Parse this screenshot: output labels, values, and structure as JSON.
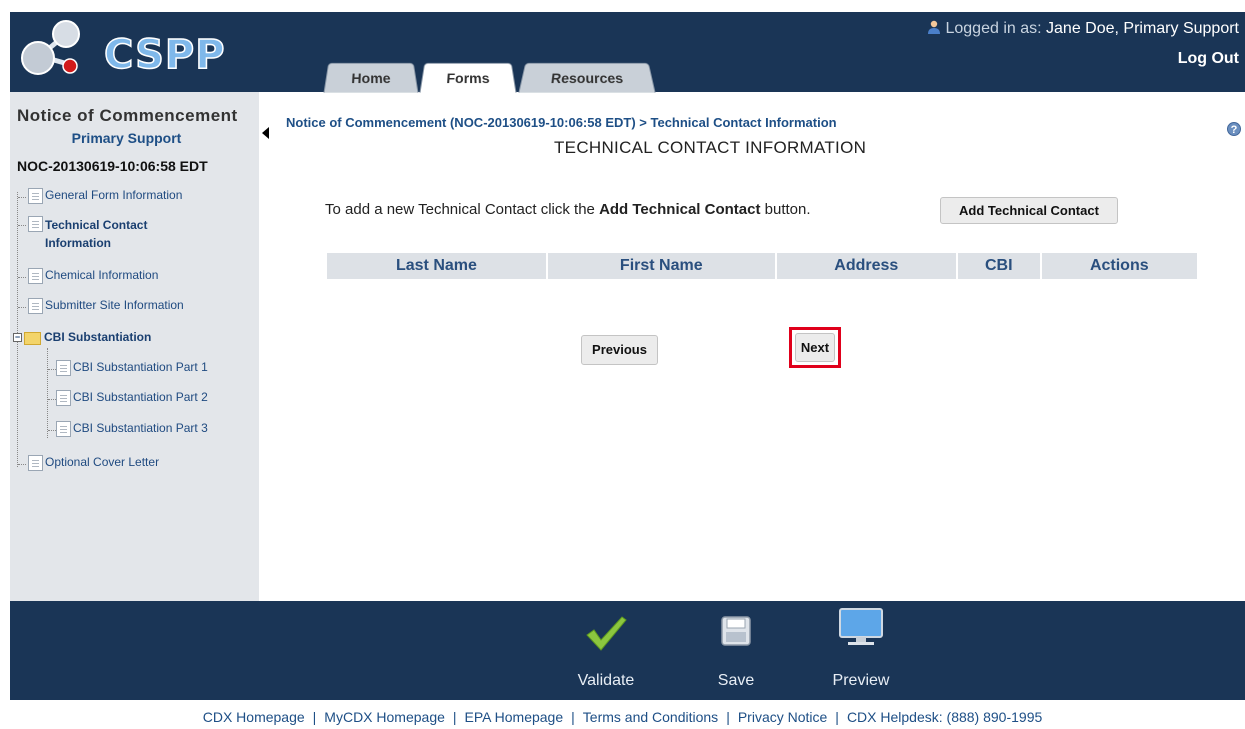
{
  "header": {
    "logo_text": "CSPP",
    "tabs": [
      {
        "label": "Home",
        "active": false
      },
      {
        "label": "Forms",
        "active": true
      },
      {
        "label": "Resources",
        "active": false
      }
    ],
    "logged_in_prefix": "Logged in as:",
    "user_name": "Jane Doe, Primary Support",
    "logout_label": "Log Out"
  },
  "sidebar": {
    "title": "Notice of Commencement",
    "role": "Primary Support",
    "form_id": "NOC-20130619-10:06:58 EDT",
    "items": [
      {
        "label": "General Form Information"
      },
      {
        "label": "Technical Contact",
        "label2": "Information"
      },
      {
        "label": "Chemical Information"
      },
      {
        "label": "Submitter Site Information"
      },
      {
        "label": "CBI Substantiation"
      },
      {
        "label": "CBI Substantiation Part 1"
      },
      {
        "label": "CBI Substantiation Part 2"
      },
      {
        "label": "CBI Substantiation Part 3"
      },
      {
        "label": "Optional Cover Letter"
      }
    ]
  },
  "main": {
    "breadcrumb": "Notice of Commencement (NOC-20130619-10:06:58 EDT) > Technical Contact Information",
    "title": "TECHNICAL CONTACT INFORMATION",
    "instructions_pre": "To add a new Technical Contact click the",
    "instructions_bold": "Add Technical Contact",
    "instructions_post": "button.",
    "add_button": "Add Technical Contact",
    "table_headers": [
      "Last Name",
      "First Name",
      "Address",
      "CBI",
      "Actions"
    ],
    "previous_button": "Previous",
    "next_button": "Next"
  },
  "toolbar": {
    "validate": "Validate",
    "save": "Save",
    "preview": "Preview"
  },
  "footer": {
    "links": [
      "CDX Homepage",
      "MyCDX Homepage",
      "EPA Homepage",
      "Terms and Conditions",
      "Privacy Notice",
      "CDX Helpdesk: (888) 890-1995"
    ],
    "separator": "|"
  },
  "colors": {
    "header_bg": "#1a3556",
    "link_blue": "#1e4f86",
    "highlight_red": "#e0001b",
    "validate_green": "#8cc63f"
  }
}
